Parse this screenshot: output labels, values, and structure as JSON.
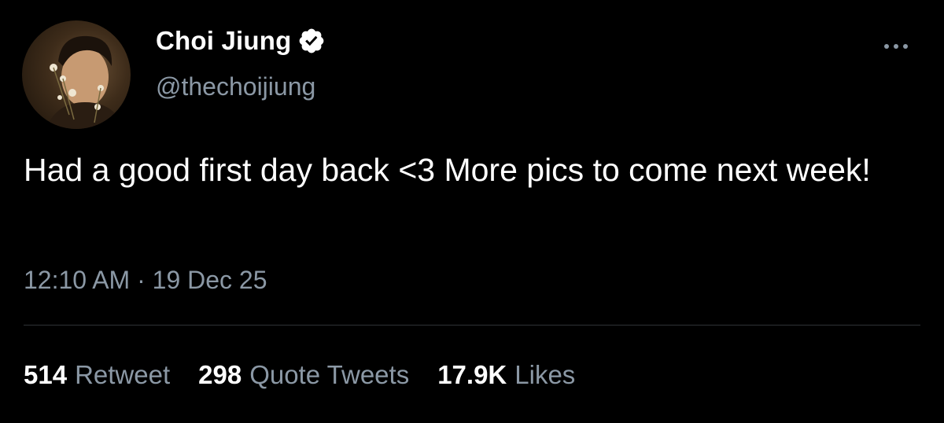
{
  "user": {
    "display_name": "Choi Jiung",
    "handle": "@thechoijiung",
    "verified": true
  },
  "tweet": {
    "text": "Had a good first day back <3 More pics to come next week!",
    "timestamp": "12:10 AM · 19 Dec 25"
  },
  "stats": {
    "retweets": {
      "count": "514",
      "label": "Retweet"
    },
    "quotes": {
      "count": "298",
      "label": "Quote Tweets"
    },
    "likes": {
      "count": "17.9K",
      "label": "Likes"
    }
  },
  "icons": {
    "verified": "verified-badge-icon",
    "more": "more-options-icon"
  },
  "colors": {
    "background": "#000000",
    "text": "#ffffff",
    "secondary": "#8b98a5",
    "divider": "#2f3336"
  }
}
